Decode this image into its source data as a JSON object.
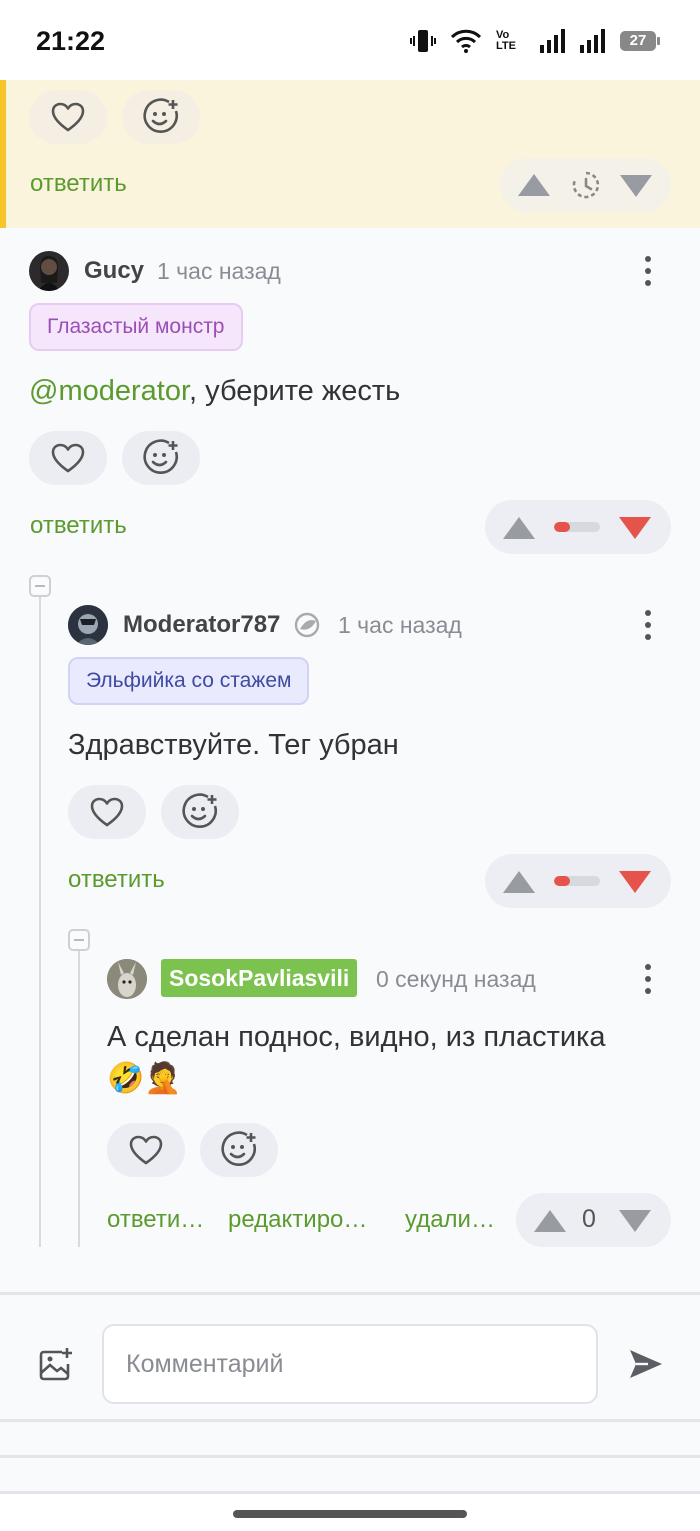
{
  "status_bar": {
    "time": "21:22",
    "volte": "Vo LTE",
    "battery": "27"
  },
  "highlighted_comment": {
    "reply_label": "ответить"
  },
  "comment1": {
    "username": "Gucy",
    "time": "1 час назад",
    "badge": "Глазастый монстр",
    "mention": "@moderator",
    "text": ", уберите жесть",
    "reply_label": "ответить",
    "rating_fraction": 0.35
  },
  "comment2": {
    "username": "Moderator787",
    "time": "1 час назад",
    "badge": "Эльфийка со стажем",
    "text": "Здравствуйте. Тег убран",
    "reply_label": "ответить",
    "rating_fraction": 0.35
  },
  "comment3": {
    "username": "SosokPavliasvili",
    "time": "0 секунд назад",
    "text": "А сделан поднос, видно, из пластика",
    "emoji": "🤣🤦",
    "reply_label": "ответи…",
    "edit_label": "редактиро…",
    "delete_label": "удали…",
    "score": "0"
  },
  "composer": {
    "placeholder": "Комментарий"
  },
  "colors": {
    "accent_green": "#5b9b2e",
    "downvote_red": "#e5534b",
    "highlight_bg": "#fbf4dd",
    "highlight_bar": "#f7c52b"
  }
}
